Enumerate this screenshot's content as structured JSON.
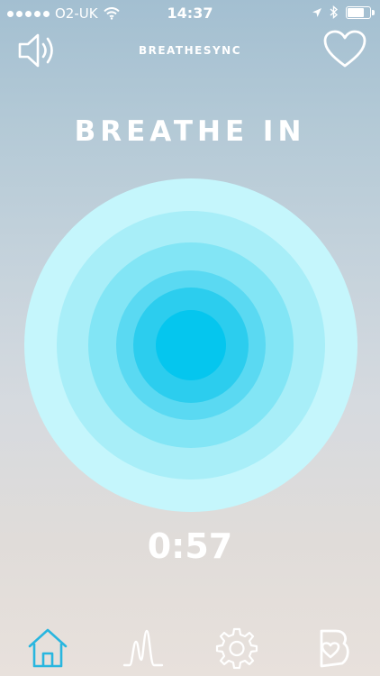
{
  "status_bar": {
    "carrier": "O2-UK",
    "time": "14:37",
    "battery_level": 0.75,
    "icons": [
      "signal-dots-icon",
      "wifi-icon",
      "location-arrow-icon",
      "bluetooth-icon",
      "battery-icon"
    ]
  },
  "header": {
    "title": "BREATHESYNC",
    "left_icon": "speaker-icon",
    "right_icon": "heart-icon"
  },
  "session": {
    "instruction": "BREATHE IN",
    "timer": "0:57"
  },
  "colors": {
    "ring_1": "#c5f6fc",
    "ring_2": "#a8eef8",
    "ring_3": "#82e5f5",
    "ring_4": "#5ad9f2",
    "ring_5": "#2ccdee",
    "ring_6": "#05c6ee",
    "active_tab": "#29b6df",
    "inactive_tab": "#ffffff"
  },
  "tabs": [
    {
      "icon": "home-icon",
      "active": true
    },
    {
      "icon": "heart-rate-chart-icon",
      "active": false
    },
    {
      "icon": "gear-icon",
      "active": false
    },
    {
      "icon": "app-logo-icon",
      "active": false
    }
  ]
}
